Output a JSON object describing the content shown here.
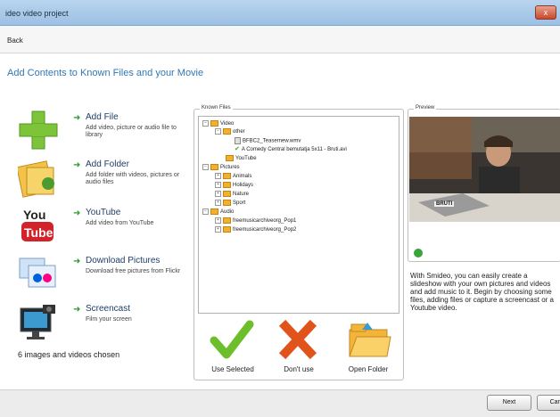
{
  "window": {
    "title": "ideo video project",
    "close_glyph": "x"
  },
  "nav": {
    "back_label": "Back"
  },
  "heading": "Add Contents to Known Files and your Movie",
  "actions": [
    {
      "icon": "plus-icon",
      "label": "Add File",
      "desc": "Add video, picture or audio file to library"
    },
    {
      "icon": "folder-icon",
      "label": "Add Folder",
      "desc": "Add folder with videos, pictures or audio files"
    },
    {
      "icon": "youtube-icon",
      "label": "YouTube",
      "desc": "Add video from YouTube"
    },
    {
      "icon": "flickr-icon",
      "label": "Download Pictures",
      "desc": "Download free pictures from Flickr"
    },
    {
      "icon": "screencast-icon",
      "label": "Screencast",
      "desc": "Film your screen"
    }
  ],
  "summary": "6 images and videos chosen",
  "known_files": {
    "title": "Known Files",
    "tree": {
      "video": "Video",
      "other": "other",
      "file1": "BFBC2_Teasernew.wmv",
      "file2": "A Comedy Central bemutatja 5x11 - Bruti.avi",
      "youtube": "YouTube",
      "pictures": "Pictures",
      "animals": "Animals",
      "holidays": "Holidays",
      "nature": "Nature",
      "sport": "Sport",
      "audio": "Audio",
      "pop1": "freemusicarchiveorg_Pop1",
      "pop2": "freemusicarchiveorg_Pop2"
    },
    "buttons": {
      "use_selected": "Use Selected",
      "dont_use": "Don't use",
      "open_folder": "Open Folder"
    }
  },
  "preview": {
    "title": "Preview",
    "subtitle": "BRUTI",
    "description": "With Smideo, you can easily create a slideshow with your own pictures and videos and add music to it. Begin by choosing some files, adding files or capture a screencast or a Youtube video."
  },
  "footer": {
    "next_label": "Next",
    "cancel_label": "Can"
  },
  "colors": {
    "accent": "#2e78b8",
    "green": "#3aa33a",
    "red": "#e0541c",
    "folder": "#f0b030"
  }
}
